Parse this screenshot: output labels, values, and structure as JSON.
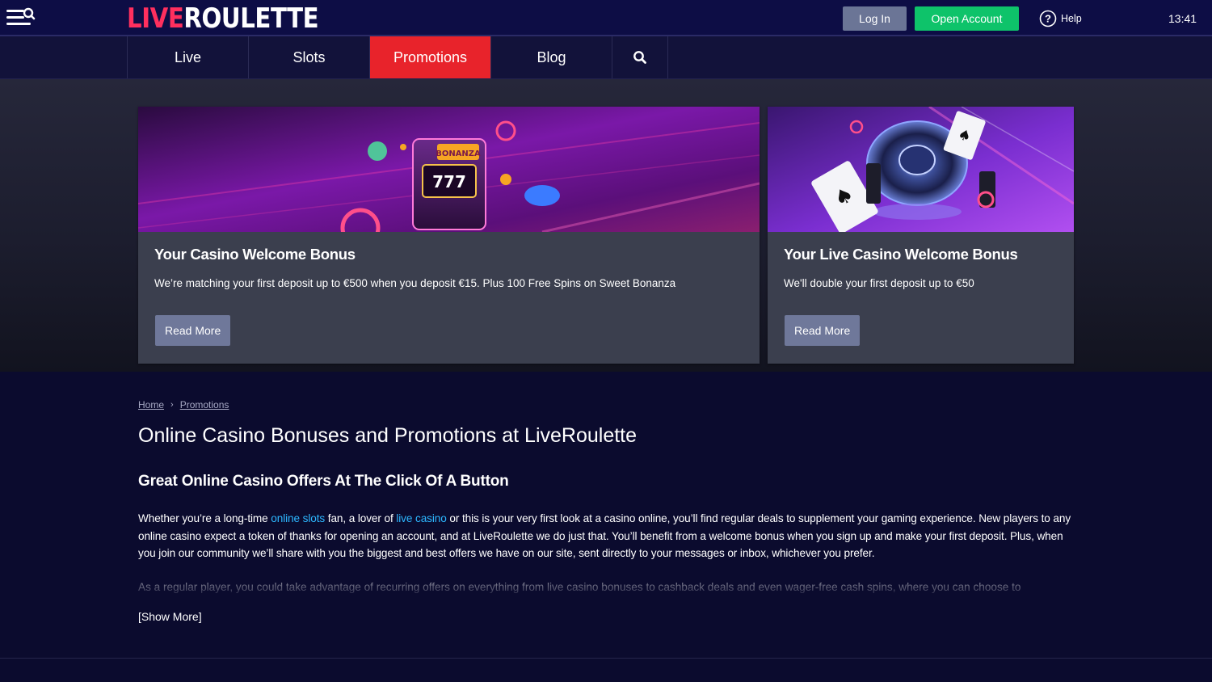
{
  "header": {
    "logo_live": "LIVE",
    "logo_roulette": "ROULETTE",
    "login_label": "Log In",
    "open_account_label": "Open Account",
    "help_label": "Help",
    "time": "13:41"
  },
  "nav": {
    "items": [
      {
        "label": "Live",
        "active": false
      },
      {
        "label": "Slots",
        "active": false
      },
      {
        "label": "Promotions",
        "active": true
      },
      {
        "label": "Blog",
        "active": false
      }
    ],
    "search_icon": "search-icon"
  },
  "promos": [
    {
      "title": "Your Casino Welcome Bonus",
      "text": "We’re matching your first deposit up to €500 when you deposit €15. Plus 100 Free Spins on Sweet Bonanza",
      "button": "Read More",
      "image": "slot-machine-banner"
    },
    {
      "title": "Your Live Casino Welcome Bonus",
      "text": "We'll double your first deposit up to €50",
      "button": "Read More",
      "image": "roulette-wheel-banner"
    }
  ],
  "breadcrumb": {
    "home": "Home",
    "separator": "›",
    "current": "Promotions"
  },
  "content": {
    "title": "Online Casino Bonuses and Promotions at LiveRoulette",
    "subheading": "Great Online Casino Offers At The Click Of A Button",
    "p1_a": "Whether you’re a long-time ",
    "p1_link1": "online slots",
    "p1_b": " fan, a lover of ",
    "p1_link2": "live casino",
    "p1_c": " or this is your very first look at a casino online, you’ll find regular deals to supplement your gaming experience. New players to any online casino expect a token of thanks for opening an account, and at LiveRoulette we do just that. You’ll benefit from a welcome bonus when you sign up and make your first deposit. Plus, when you join our community we’ll share with you the biggest and best offers we have on our site, sent directly to your messages or inbox, whichever you prefer.",
    "p2": "As a regular player, you could take advantage of recurring offers on everything from live casino bonuses to cashback deals and even wager-free cash spins, where you can choose to",
    "show_more": "[Show More]"
  },
  "colors": {
    "accent_red": "#e8232b",
    "logo_pink": "#ff2f5e",
    "open_account_green": "#0ec36a",
    "link_blue": "#2db7ff",
    "background": "#0b0b2e"
  }
}
